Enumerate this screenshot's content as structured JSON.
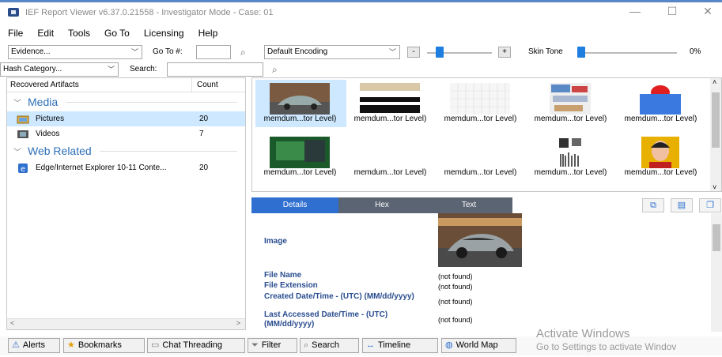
{
  "window": {
    "title": "IEF Report Viewer v6.37.0.21558 - Investigator Mode - Case: 01",
    "minimize": "—",
    "maximize": "☐",
    "close": "✕"
  },
  "menu": [
    "File",
    "Edit",
    "Tools",
    "Go To",
    "Licensing",
    "Help"
  ],
  "toolbar": {
    "evidence_select": "Evidence...",
    "goto_label": "Go To #:",
    "goto_value": "",
    "encoding_select": "Default Encoding",
    "minus_label": "-",
    "plus_label": "+",
    "zoom_level": 0.15,
    "skin_tone_label": "Skin Tone",
    "skin_tone_value": "0%",
    "skin_tone_level": 0.0,
    "hash_select": "Hash Category...",
    "search_label": "Search:",
    "search_value": ""
  },
  "artifacts": {
    "col_name": "Recovered Artifacts",
    "col_count": "Count",
    "groups": [
      {
        "name": "Media",
        "items": [
          {
            "name": "Pictures",
            "count": "20",
            "selected": true
          },
          {
            "name": "Videos",
            "count": "7",
            "selected": false
          }
        ]
      },
      {
        "name": "Web Related",
        "items": [
          {
            "name": "Edge/Internet Explorer 10-11 Conte...",
            "count": "20",
            "selected": false
          }
        ]
      }
    ],
    "scroll_left": "<",
    "scroll_right": ">"
  },
  "thumbnails": [
    {
      "caption": "memdum...tor Level)",
      "selected": true
    },
    {
      "caption": "memdum...tor Level)",
      "selected": false
    },
    {
      "caption": "memdum...tor Level)",
      "selected": false
    },
    {
      "caption": "memdum...tor Level)",
      "selected": false
    },
    {
      "caption": "memdum...tor Level)",
      "selected": false
    },
    {
      "caption": "memdum...tor Level)",
      "selected": false
    },
    {
      "caption": "memdum...tor Level)",
      "selected": false
    },
    {
      "caption": "memdum...tor Level)",
      "selected": false
    },
    {
      "caption": "memdum...tor Level)",
      "selected": false
    },
    {
      "caption": "memdum...tor Level)",
      "selected": false
    }
  ],
  "detail_tabs": [
    "Details",
    "Hex",
    "Text"
  ],
  "details": {
    "image_label": "Image",
    "fields": [
      {
        "label": "File Name",
        "value": "(not found)"
      },
      {
        "label": "File Extension",
        "value": "(not found)"
      },
      {
        "label": "Created Date/Time - (UTC) (MM/dd/yyyy)",
        "value": "(not found)"
      },
      {
        "label": "Last Accessed Date/Time - (UTC) (MM/dd/yyyy)",
        "value": "(not found)"
      }
    ]
  },
  "bottom_buttons": [
    "Alerts",
    "Bookmarks",
    "Chat Threading",
    "Filter",
    "Search",
    "Timeline",
    "World Map"
  ],
  "watermark": {
    "line1": "Activate Windows",
    "line2": "Go to Settings to activate Windov"
  },
  "colors": {
    "accent": "#2f6fd0",
    "group_text": "#2d6fb8",
    "selection": "#cde8ff",
    "detail_label": "#2a4d8f"
  }
}
